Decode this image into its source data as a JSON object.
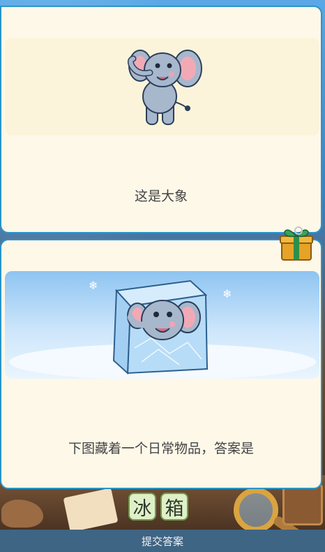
{
  "top_card": {
    "image_icon": "elephant-icon",
    "caption": "这是大象"
  },
  "bottom_card": {
    "image_icon": "elephant-in-ice-cube-icon",
    "caption": "下图藏着一个日常物品，答案是"
  },
  "gift_icon": "gift-box-icon",
  "answer": {
    "chars": [
      "冰",
      "箱"
    ]
  },
  "submit": {
    "label": "提交答案"
  }
}
